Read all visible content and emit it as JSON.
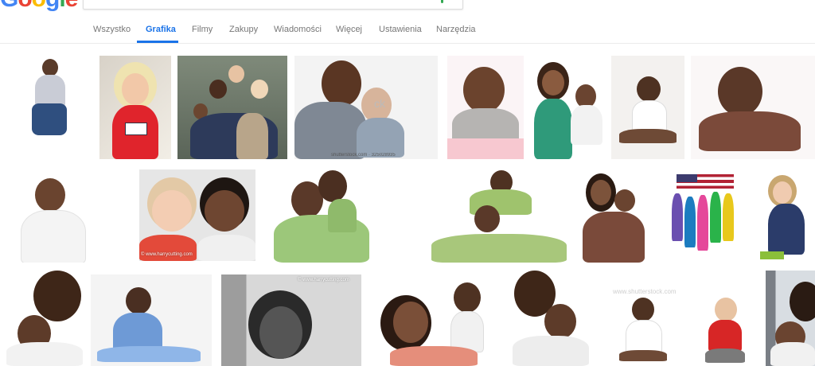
{
  "logo": {
    "letters": [
      "G",
      "o",
      "o",
      "g",
      "l",
      "e"
    ],
    "colors": [
      "#4285f4",
      "#ea4335",
      "#fbbc05",
      "#4285f4",
      "#34a853",
      "#ea4335"
    ]
  },
  "tabs": [
    {
      "label": "Wszystko",
      "active": false
    },
    {
      "label": "Grafika",
      "active": true
    },
    {
      "label": "Filmy",
      "active": false
    },
    {
      "label": "Zakupy",
      "active": false
    },
    {
      "label": "Wiadomości",
      "active": false
    },
    {
      "label": "Więcej",
      "active": false
    },
    {
      "label": "Ustawienia",
      "active": false
    },
    {
      "label": "Narzędzia",
      "active": false
    }
  ],
  "colors": {
    "accent": "#1a73e8",
    "tab_text": "#777777",
    "divider": "#ebebeb"
  },
  "watermarks": {
    "shutterstock_main": "shutterstock.com · 325028935",
    "shutterstock_overlay": "ck",
    "harrycutting_1": "© www.harrycutting.com",
    "harrycutting_2": "© www.harrycutting.com",
    "small_1": "www.shutterstock.com"
  },
  "results": [
    {
      "name": "jumping-toddler"
    },
    {
      "name": "blonde-girl-flag-shirt"
    },
    {
      "name": "family-group-photo"
    },
    {
      "name": "father-with-baby"
    },
    {
      "name": "baby-pink-blanket"
    },
    {
      "name": "mother-holding-baby"
    },
    {
      "name": "baby-sitting-white"
    },
    {
      "name": "baby-crawling-brown"
    },
    {
      "name": "child-profile"
    },
    {
      "name": "two-kids-smiling"
    },
    {
      "name": "man-with-boy-piggyback"
    },
    {
      "name": "man-boy-shoulders"
    },
    {
      "name": "mother-child-hug"
    },
    {
      "name": "kids-with-flag"
    },
    {
      "name": "girl-flag-dress"
    },
    {
      "name": "father-kissing-baby"
    },
    {
      "name": "baby-blue-dress"
    },
    {
      "name": "boy-black-white"
    },
    {
      "name": "mother-baby-play"
    },
    {
      "name": "father-baby-closeup"
    },
    {
      "name": "baby-white-outfit"
    },
    {
      "name": "baby-red-shirt"
    },
    {
      "name": "woman-baby-window"
    }
  ]
}
